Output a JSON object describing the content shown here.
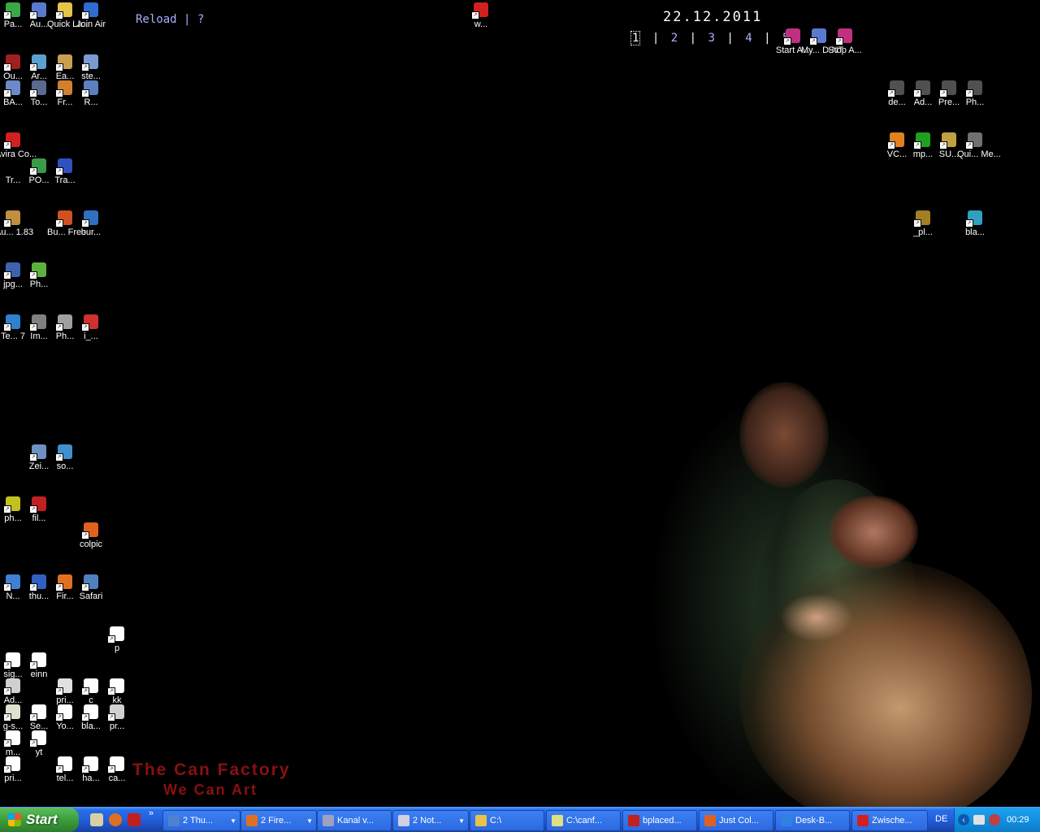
{
  "desktop": {
    "reload_label": "Reload",
    "separator": "|",
    "help_label": "?",
    "date": "22.12.2011",
    "desktops": [
      "1",
      "2",
      "3",
      "4",
      "5"
    ],
    "desktop_sep": "|",
    "brand_line1": "The Can Factory",
    "brand_line2": "We Can Art",
    "icons": [
      {
        "label": "Pa...",
        "icon": "recycle-icon",
        "color": "#3aa845"
      },
      {
        "label": "Au...",
        "icon": "window-icon",
        "color": "#5a7ad0"
      },
      {
        "label": "Quick La...",
        "icon": "folder-icon",
        "color": "#e8c34a"
      },
      {
        "label": "Join Air",
        "icon": "globe-icon",
        "color": "#2f6bd0"
      },
      {
        "label": "Ou...",
        "icon": "app-icon",
        "color": "#a02020"
      },
      {
        "label": "Ar...",
        "icon": "app-icon",
        "color": "#5aa0d0"
      },
      {
        "label": "Ea...",
        "icon": "app-icon",
        "color": "#c8a050"
      },
      {
        "label": "ste...",
        "icon": "app-icon",
        "color": "#7a9ad0"
      },
      {
        "label": "BA...",
        "icon": "app-icon",
        "color": "#6a8ac8"
      },
      {
        "label": "To...",
        "icon": "app-icon",
        "color": "#5a6a90"
      },
      {
        "label": "Fr...",
        "icon": "app-icon",
        "color": "#d08030"
      },
      {
        "label": "R...",
        "icon": "app-icon",
        "color": "#5a80c0"
      },
      {
        "label": "Avira Co...",
        "icon": "avira-icon",
        "color": "#d02020"
      },
      {
        "label": "Tr...",
        "icon": "",
        "color": ""
      },
      {
        "label": "PO...",
        "icon": "app-icon",
        "color": "#3a9a4a"
      },
      {
        "label": "Tra...",
        "icon": "app-icon",
        "color": "#3050c0"
      },
      {
        "label": "Au... 1.83",
        "icon": "app-icon",
        "color": "#c09040"
      },
      {
        "label": "Bu... Free",
        "icon": "app-icon",
        "color": "#d05020"
      },
      {
        "label": "bur...",
        "icon": "app-icon",
        "color": "#3070c0"
      },
      {
        "label": "jpg...",
        "icon": "app-icon",
        "color": "#4060b0"
      },
      {
        "label": "Ph...",
        "icon": "app-icon",
        "color": "#60b040"
      },
      {
        "label": "Te... 7",
        "icon": "app-icon",
        "color": "#3080d0"
      },
      {
        "label": "Im...",
        "icon": "app-icon",
        "color": "#808080"
      },
      {
        "label": "Ph...",
        "icon": "app-icon",
        "color": "#a0a0a0"
      },
      {
        "label": "i_...",
        "icon": "app-icon",
        "color": "#d03030"
      },
      {
        "label": "Zei...",
        "icon": "app-icon",
        "color": "#7090c0"
      },
      {
        "label": "so...",
        "icon": "app-icon",
        "color": "#4090d0"
      },
      {
        "label": "ph...",
        "icon": "app-icon",
        "color": "#c0c020"
      },
      {
        "label": "fil...",
        "icon": "filezilla-icon",
        "color": "#c02020"
      },
      {
        "label": "colpic",
        "icon": "colpic-icon",
        "color": "#e06020"
      },
      {
        "label": "N...",
        "icon": "app-icon",
        "color": "#4080d0"
      },
      {
        "label": "thu...",
        "icon": "app-icon",
        "color": "#3060c0"
      },
      {
        "label": "Fir...",
        "icon": "firefox-icon",
        "color": "#e07020"
      },
      {
        "label": "Safari",
        "icon": "safari-icon",
        "color": "#5080c0"
      },
      {
        "label": "p",
        "icon": "file-icon",
        "color": "#ffffff"
      },
      {
        "label": "sig...",
        "icon": "file-icon",
        "color": "#ffffff"
      },
      {
        "label": "einn",
        "icon": "file-icon",
        "color": "#ffffff"
      },
      {
        "label": "Ad...",
        "icon": "file-icon",
        "color": "#d0d0d0"
      },
      {
        "label": "pri...",
        "icon": "file-icon",
        "color": "#e0e0e0"
      },
      {
        "label": "c",
        "icon": "file-icon",
        "color": "#ffffff"
      },
      {
        "label": "kk",
        "icon": "file-icon",
        "color": "#ffffff"
      },
      {
        "label": "g-s...",
        "icon": "file-icon",
        "color": "#e0e0d0"
      },
      {
        "label": "Se...",
        "icon": "file-icon",
        "color": "#ffffff"
      },
      {
        "label": "Yo...",
        "icon": "file-icon",
        "color": "#ffffff"
      },
      {
        "label": "bla...",
        "icon": "file-icon",
        "color": "#ffffff"
      },
      {
        "label": "pr...",
        "icon": "file-icon",
        "color": "#d0d0d0"
      },
      {
        "label": "m...",
        "icon": "file-icon",
        "color": "#ffffff"
      },
      {
        "label": "yt",
        "icon": "file-icon",
        "color": "#ffffff"
      },
      {
        "label": "pri...",
        "icon": "file-icon",
        "color": "#ffffff"
      },
      {
        "label": "tel...",
        "icon": "file-icon",
        "color": "#ffffff"
      },
      {
        "label": "ha...",
        "icon": "file-icon",
        "color": "#ffffff"
      },
      {
        "label": "ca...",
        "icon": "file-icon",
        "color": "#ffffff"
      },
      {
        "label": "w...",
        "icon": "app-icon",
        "color": "#d02020"
      },
      {
        "label": "Start A...",
        "icon": "pin-icon",
        "color": "#c03080"
      },
      {
        "label": "My... D-NT",
        "icon": "window-icon",
        "color": "#5a7ad0"
      },
      {
        "label": "Stop A...",
        "icon": "pin-icon",
        "color": "#c03080"
      },
      {
        "label": "de...",
        "icon": "app-icon",
        "color": "#505050"
      },
      {
        "label": "Ad...",
        "icon": "app-icon",
        "color": "#505050"
      },
      {
        "label": "Pre...",
        "icon": "app-icon",
        "color": "#505050"
      },
      {
        "label": "Ph...",
        "icon": "app-icon",
        "color": "#505050"
      },
      {
        "label": "VC...",
        "icon": "vlc-icon",
        "color": "#e08020"
      },
      {
        "label": "mp...",
        "icon": "app-icon",
        "color": "#20a020"
      },
      {
        "label": "SU...",
        "icon": "app-icon",
        "color": "#c0a040"
      },
      {
        "label": "Qui... Me...",
        "icon": "app-icon",
        "color": "#707070"
      },
      {
        "label": "_pl...",
        "icon": "app-icon",
        "color": "#a08020"
      },
      {
        "label": "bla...",
        "icon": "app-icon",
        "color": "#30a0c0"
      }
    ]
  },
  "taskbar": {
    "start_label": "Start",
    "chevron": "»",
    "tasks": [
      {
        "label": "2 Thu...",
        "color": "#5080d0",
        "dropdown": "▼"
      },
      {
        "label": "2 Fire...",
        "color": "#e07020",
        "dropdown": "▼"
      },
      {
        "label": "Kanal v...",
        "color": "#a0a0c0",
        "dropdown": ""
      },
      {
        "label": "2 Not...",
        "color": "#d0d0e0",
        "dropdown": "▼"
      },
      {
        "label": "C:\\",
        "color": "#e8c34a",
        "dropdown": ""
      },
      {
        "label": "C:\\canf...",
        "color": "#e0e080",
        "dropdown": ""
      },
      {
        "label": "bplaced...",
        "color": "#c02020",
        "dropdown": ""
      },
      {
        "label": "Just Col...",
        "color": "#e06020",
        "dropdown": ""
      },
      {
        "label": "Desk-B...",
        "color": "#3080e0",
        "dropdown": ""
      },
      {
        "label": "Zwische...",
        "color": "#d02020",
        "dropdown": ""
      }
    ],
    "language": "DE",
    "clock": "00:29"
  }
}
